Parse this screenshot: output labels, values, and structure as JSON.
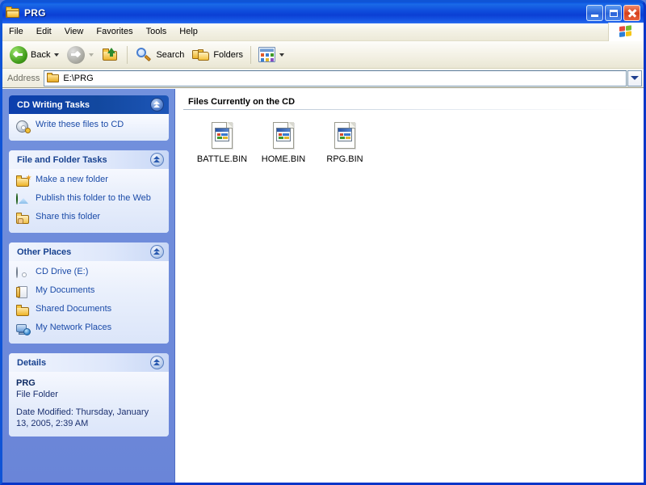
{
  "window": {
    "title": "PRG",
    "title_icon": "folder-icon",
    "buttons": {
      "minimize": "Minimize",
      "maximize": "Maximize",
      "close": "Close"
    }
  },
  "menubar": {
    "items": [
      "File",
      "Edit",
      "View",
      "Favorites",
      "Tools",
      "Help"
    ],
    "logo": "windows-flag-logo"
  },
  "toolbar": {
    "back": "Back",
    "forward": "",
    "up": "",
    "search": "Search",
    "folders": "Folders",
    "views": ""
  },
  "address": {
    "label": "Address",
    "value": "E:\\PRG",
    "icon": "folder-icon"
  },
  "sidebar": {
    "panels": [
      {
        "title": "CD Writing Tasks",
        "style": "dark",
        "tasks": [
          {
            "label": "Write these files to CD",
            "icon": "cd-write-icon"
          }
        ]
      },
      {
        "title": "File and Folder Tasks",
        "style": "light",
        "tasks": [
          {
            "label": "Make a new folder",
            "icon": "new-folder-icon"
          },
          {
            "label": "Publish this folder to the Web",
            "icon": "globe-icon"
          },
          {
            "label": "Share this folder",
            "icon": "share-folder-icon"
          }
        ]
      },
      {
        "title": "Other Places",
        "style": "light",
        "tasks": [
          {
            "label": "CD Drive (E:)",
            "icon": "cd-drive-icon"
          },
          {
            "label": "My Documents",
            "icon": "documents-icon"
          },
          {
            "label": "Shared Documents",
            "icon": "shared-folder-icon"
          },
          {
            "label": "My Network Places",
            "icon": "network-icon"
          }
        ]
      }
    ],
    "details": {
      "title": "Details",
      "name": "PRG",
      "type": "File Folder",
      "date_modified": "Date Modified: Thursday, January 13, 2005, 2:39 AM"
    }
  },
  "content": {
    "group_header": "Files Currently on the CD",
    "files": [
      {
        "name": "BATTLE.BIN",
        "icon": "generic-file-icon"
      },
      {
        "name": "HOME.BIN",
        "icon": "generic-file-icon"
      },
      {
        "name": "RPG.BIN",
        "icon": "generic-file-icon"
      }
    ]
  },
  "colors": {
    "title_blue": "#0b3fd4",
    "sidebar_blue": "#6a85d8",
    "panel_header_dark": "#0c3fae",
    "link_blue": "#1b4ba8",
    "close_red": "#d6401c"
  }
}
